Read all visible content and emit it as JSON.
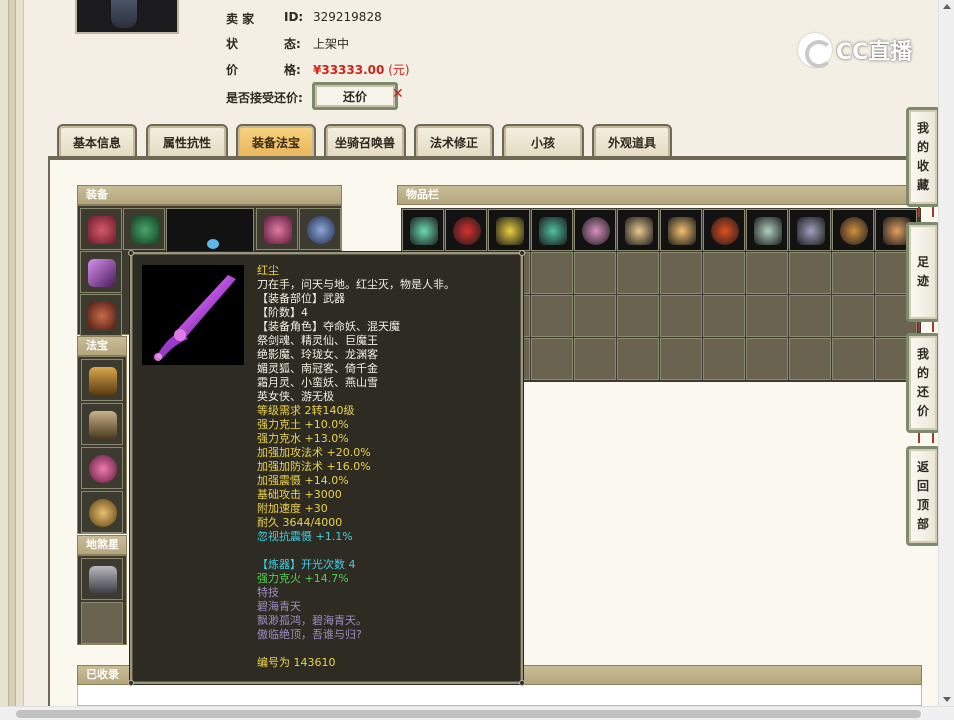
{
  "seller": {
    "id_label_1": "卖  家",
    "id_label_2": "ID:",
    "id_value": "329219828",
    "status_label_1": "状",
    "status_label_2": "态:",
    "status_value": "上架中",
    "price_label_1": "价",
    "price_label_2": "格:",
    "price_value": "¥33333.00",
    "price_unit": "(元)",
    "counter_offer_label": "是否接受还价:",
    "counter_offer_button": "还价",
    "counter_offer_mark": "✕"
  },
  "brand": {
    "logo_text": "CC直播"
  },
  "tabs": [
    {
      "label": "基本信息"
    },
    {
      "label": "属性抗性"
    },
    {
      "label": "装备法宝"
    },
    {
      "label": "坐骑召唤兽"
    },
    {
      "label": "法术修正"
    },
    {
      "label": "小孩"
    },
    {
      "label": "外观道具"
    }
  ],
  "active_tab": "装备法宝",
  "sections": {
    "equipment": "装备",
    "treasure": "法宝",
    "earth_spirit": "地煞星",
    "inventory": "物品栏",
    "collected": "已收录"
  },
  "tooltip": {
    "name": "红尘",
    "lines": [
      {
        "text": "刀在手，问天与地。红尘灭，物是人非。",
        "color": "white"
      },
      {
        "text": "【装备部位】武器",
        "color": "white"
      },
      {
        "text": "【阶数】4",
        "color": "white"
      },
      {
        "text": "【装备角色】夺命妖、混天魔",
        "color": "white"
      },
      {
        "text": "祭剑魂、精灵仙、巨魔王",
        "color": "white"
      },
      {
        "text": "绝影魔、玲珑女、龙渊客",
        "color": "white"
      },
      {
        "text": "媚灵狐、南冠客、倚千金",
        "color": "white"
      },
      {
        "text": "霜月灵、小蛮妖、燕山雪",
        "color": "white"
      },
      {
        "text": "英女侠、游无极",
        "color": "white"
      },
      {
        "text": "等级需求 2转140级",
        "color": "yellow"
      },
      {
        "text": "强力克土 +10.0%",
        "color": "yellow"
      },
      {
        "text": "强力克水 +13.0%",
        "color": "yellow"
      },
      {
        "text": "加强加攻法术 +20.0%",
        "color": "yellow"
      },
      {
        "text": "加强加防法术 +16.0%",
        "color": "yellow"
      },
      {
        "text": "加强震慑 +14.0%",
        "color": "yellow"
      },
      {
        "text": "基础攻击 +3000",
        "color": "yellow"
      },
      {
        "text": "附加速度 +30",
        "color": "yellow"
      },
      {
        "text": "耐久 3644/4000",
        "color": "yellow"
      },
      {
        "text": "忽视抗震慑 +1.1%",
        "color": "cyan"
      },
      {
        "text": "",
        "color": "white"
      },
      {
        "text": "【炼器】开光次数 4",
        "color": "cyan"
      },
      {
        "text": "强力克火 +14.7%",
        "color": "green"
      },
      {
        "text": "特技",
        "color": "purple"
      },
      {
        "text": "碧海青天",
        "color": "purple"
      },
      {
        "text": "飘渺孤鸿，碧海青天。",
        "color": "purple"
      },
      {
        "text": "傲临绝顶，吾谁与归?",
        "color": "purple"
      },
      {
        "text": "",
        "color": "white"
      },
      {
        "text": "编号为 143610",
        "color": "yellow"
      }
    ]
  },
  "side_buttons": [
    {
      "label": "我的收藏",
      "chars": [
        "我",
        "的",
        "收",
        "藏"
      ]
    },
    {
      "label": "足迹",
      "chars": [
        "足",
        "迹"
      ]
    },
    {
      "label": "我的还价",
      "chars": [
        "我",
        "的",
        "还",
        "价"
      ]
    },
    {
      "label": "返回顶部",
      "chars": [
        "返",
        "回",
        "顶",
        "部"
      ]
    }
  ],
  "colors": {
    "accent_tab": "#e8b35b",
    "price_red": "#d2231a",
    "panel_dark": "#2e2b22",
    "yellow_text": "#ecd34a",
    "cyan_text": "#3fd0e6",
    "green_text": "#4ed04e",
    "purple_text": "#9e8ec2"
  }
}
